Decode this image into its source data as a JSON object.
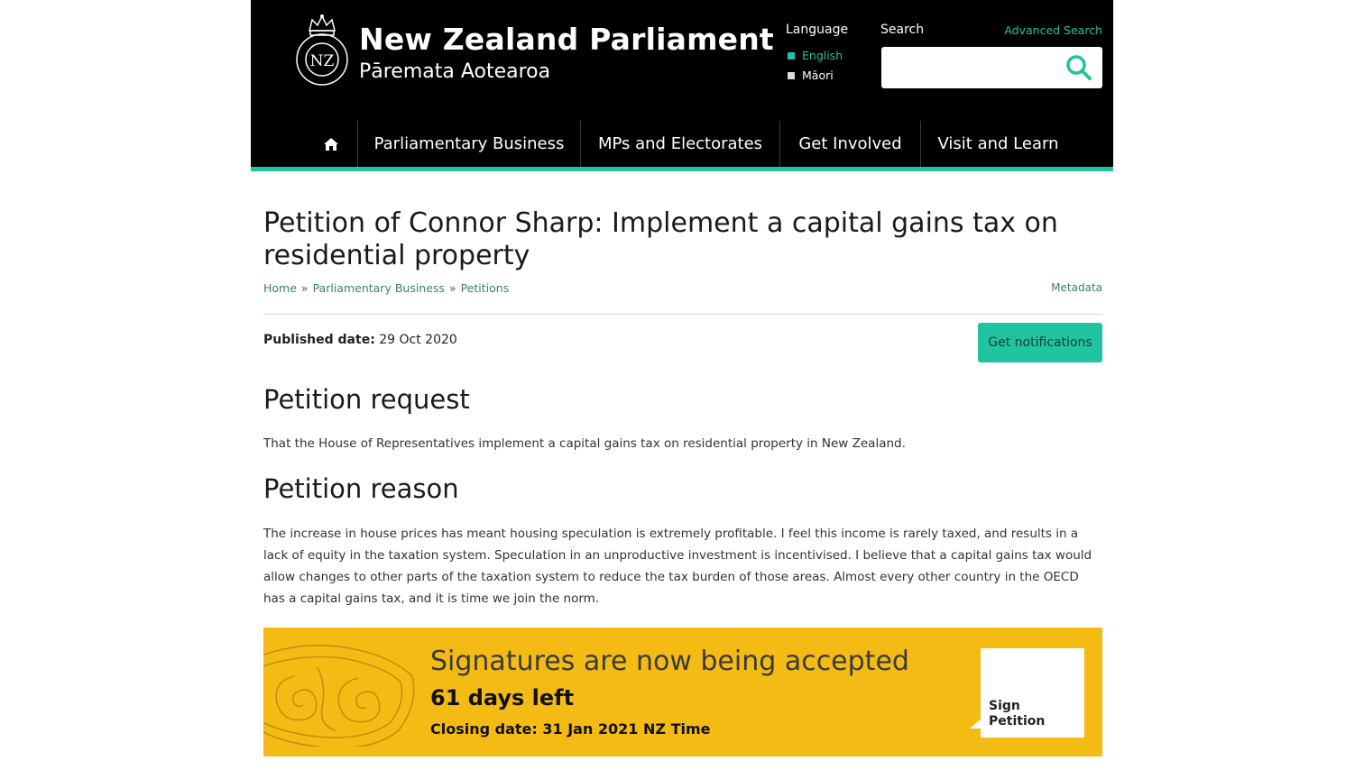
{
  "header": {
    "title": "New Zealand Parliament",
    "subtitle": "Pāremata Aotearoa",
    "crest_text": "NZ",
    "language_label": "Language",
    "languages": [
      "English",
      "Māori"
    ],
    "search_label": "Search",
    "advanced_search": "Advanced Search",
    "search_placeholder": "",
    "accent_color": "#20c4a0"
  },
  "nav": {
    "items": [
      "Parliamentary Business",
      "MPs and Electorates",
      "Get Involved",
      "Visit and Learn"
    ]
  },
  "main": {
    "title": "Petition of Connor Sharp: Implement a capital gains tax on residential property",
    "breadcrumb": [
      "Home",
      "Parliamentary Business",
      "Petitions"
    ],
    "breadcrumb_sep": "»",
    "metadata_link": "Metadata",
    "published_label": "Published date:",
    "published_value": "29 Oct 2020",
    "notify_button": "Get notifications",
    "request_heading": "Petition request",
    "request_text": "That the House of Representatives implement a capital gains tax on residential property in New Zealand.",
    "reason_heading": "Petition reason",
    "reason_text": "The increase in house prices has meant housing speculation is extremely profitable. I feel this income is rarely taxed, and results in a lack of equity in the taxation system. Speculation in an unproductive investment is incentivised. I believe that a capital gains tax would allow changes to other parts of the taxation system to reduce the tax burden of those areas. Almost every other country in the OECD has a capital gains tax, and it is time we join the norm."
  },
  "signatures": {
    "heading": "Signatures are now being accepted",
    "days_left": "61 days left",
    "closing": "Closing date: 31 Jan 2021 NZ Time",
    "sign_line1": "Sign",
    "sign_line2": "Petition",
    "banner_color": "#f5bb15"
  }
}
